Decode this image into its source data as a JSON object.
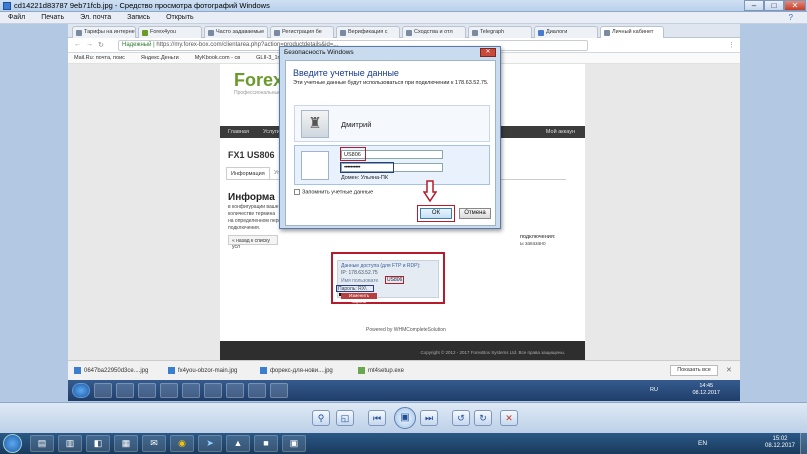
{
  "viewer": {
    "title": "cd14221d83787 9eb71fcb.jpg - Средство просмотра фотографий Windows",
    "menu": [
      "Файл",
      "Печать",
      "Эл. почта",
      "Запись",
      "Открыть"
    ],
    "toolbar_left": [
      "",
      "",
      ""
    ]
  },
  "browser": {
    "tabs": [
      "Тарифы на интерне",
      "Forex4you",
      "Часто задаваемые",
      "Регистрация бе",
      "Верификация с",
      "Сходства и отл",
      "Telegraph",
      "Диалоги",
      "Личный кабинет"
    ],
    "secure_label": "Надежный",
    "url": "https://my.forex-box.com/clientarea.php?action=productdetails&id=...",
    "bookmarks": [
      "Mail.Ru: почта, поис",
      "Яндекс.Деньги",
      "MyKbook.com - св",
      "GLII-3_1ml"
    ]
  },
  "site": {
    "logo": "ForexB",
    "logo_sub": "Профессиональные р",
    "nav": [
      "Главная",
      "Услуги"
    ],
    "nav_right": "Мой аккаун",
    "account_title": "FX1 US806",
    "tab_info": "Информация",
    "tab_other": "Упр",
    "info_heading": "Информа",
    "info_lines": [
      "в конфигурации ваше",
      "количестве термина",
      "на определенном периоде",
      "подключения."
    ],
    "back_button": "« назад к списку усл",
    "side_text": [
      "подключения:",
      "ы заказано"
    ],
    "access": {
      "title": "Данные доступа (для FTP и RDP):",
      "ip": "IP: 178.63.52.75",
      "user_label": "Имя пользовате",
      "user_value": "US806",
      "pass_label": "Пароль: RX\\",
      "change_button": "Изменить пароль"
    },
    "powered": "Powered by WHMCompleteSolution",
    "copyright": "Copyright © 2012 - 2017 ForexBox Systems Ltd. Все права защищены."
  },
  "downloads": {
    "items": [
      "0647ba22950d3ce....jpg",
      "fx4you-obzor-main.jpg",
      "форекс-для-нови....jpg",
      "mt4setup.exe"
    ],
    "show_all": "Показать все"
  },
  "inner_taskbar": {
    "lang": "RU",
    "time": "14:45",
    "date": "08.12.2017"
  },
  "dialog": {
    "title": "Безопасность Windows",
    "heading": "Введите учетные данные",
    "description": "Эти учетные данные будут использоваться при подключении к 178.63.52.75.",
    "user_name": "Дмитрий",
    "login_value": "US806",
    "password_value": "••••••••••",
    "domain": "Домен: Ульяна-ПК",
    "remember": "Запомнить учетные данные",
    "ok": "ОК",
    "cancel": "Отмена"
  },
  "taskbar": {
    "lang": "EN",
    "time": "15:02",
    "date": "08.12.2017"
  },
  "colors": {
    "annotation_red": "#b51b2a",
    "annotation_blue": "#283c8a",
    "viewer_bg": "#b3c9e3",
    "logo_green": "#6a9a2a"
  }
}
